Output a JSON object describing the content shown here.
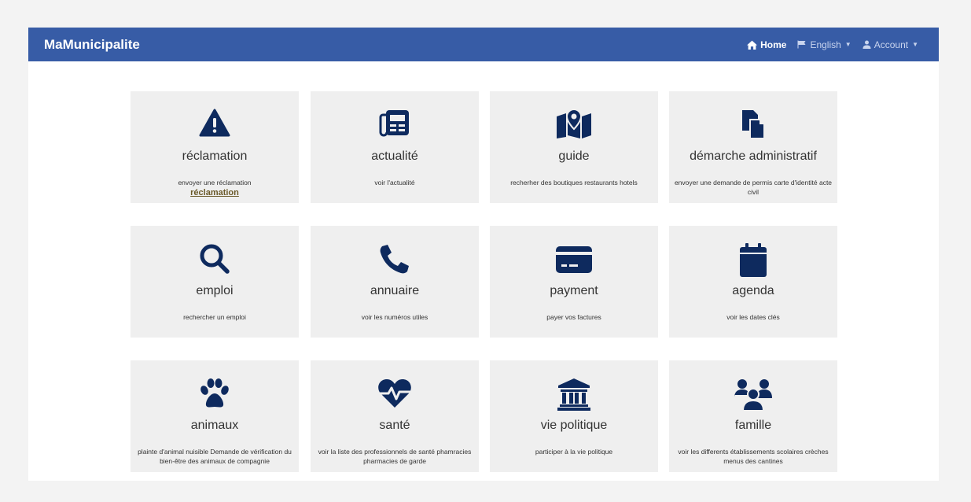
{
  "navbar": {
    "brand": "MaMunicipalite",
    "home": "Home",
    "language": "English",
    "account": "Account"
  },
  "colors": {
    "navbar": "#375ca6",
    "icon": "#0e2a5e",
    "card": "#efefef"
  },
  "cards": [
    {
      "title": "réclamation",
      "desc": "envoyer une réclamation",
      "link": "réclamation",
      "icon": "warning-icon"
    },
    {
      "title": "actualité",
      "desc": "voir l'actualité",
      "icon": "newspaper-icon"
    },
    {
      "title": "guide",
      "desc": "recherher des boutiques restaurants hotels",
      "icon": "map-icon"
    },
    {
      "title": "démarche administratif",
      "desc": "envoyer une demande de permis carte d'identité acte civil",
      "icon": "documents-icon"
    },
    {
      "title": "emploi",
      "desc": "rechercher un emploi",
      "icon": "search-icon"
    },
    {
      "title": "annuaire",
      "desc": "voir les numéros utiles",
      "icon": "phone-icon"
    },
    {
      "title": "payment",
      "desc": "payer vos factures",
      "icon": "credit-card-icon"
    },
    {
      "title": "agenda",
      "desc": "voir les dates clés",
      "icon": "calendar-icon"
    },
    {
      "title": "animaux",
      "desc": "plainte d'animal nuisible Demande de vérification du bien-être des animaux de compagnie",
      "icon": "paw-icon"
    },
    {
      "title": "santé",
      "desc": "voir la liste des professionnels de santé phamracies pharmacies de garde",
      "icon": "heartbeat-icon"
    },
    {
      "title": "vie politique",
      "desc": "participer à la vie politique",
      "icon": "institution-icon"
    },
    {
      "title": "famille",
      "desc": "voir les differents établissements scolaires crèches menus des cantines",
      "icon": "family-icon"
    }
  ]
}
